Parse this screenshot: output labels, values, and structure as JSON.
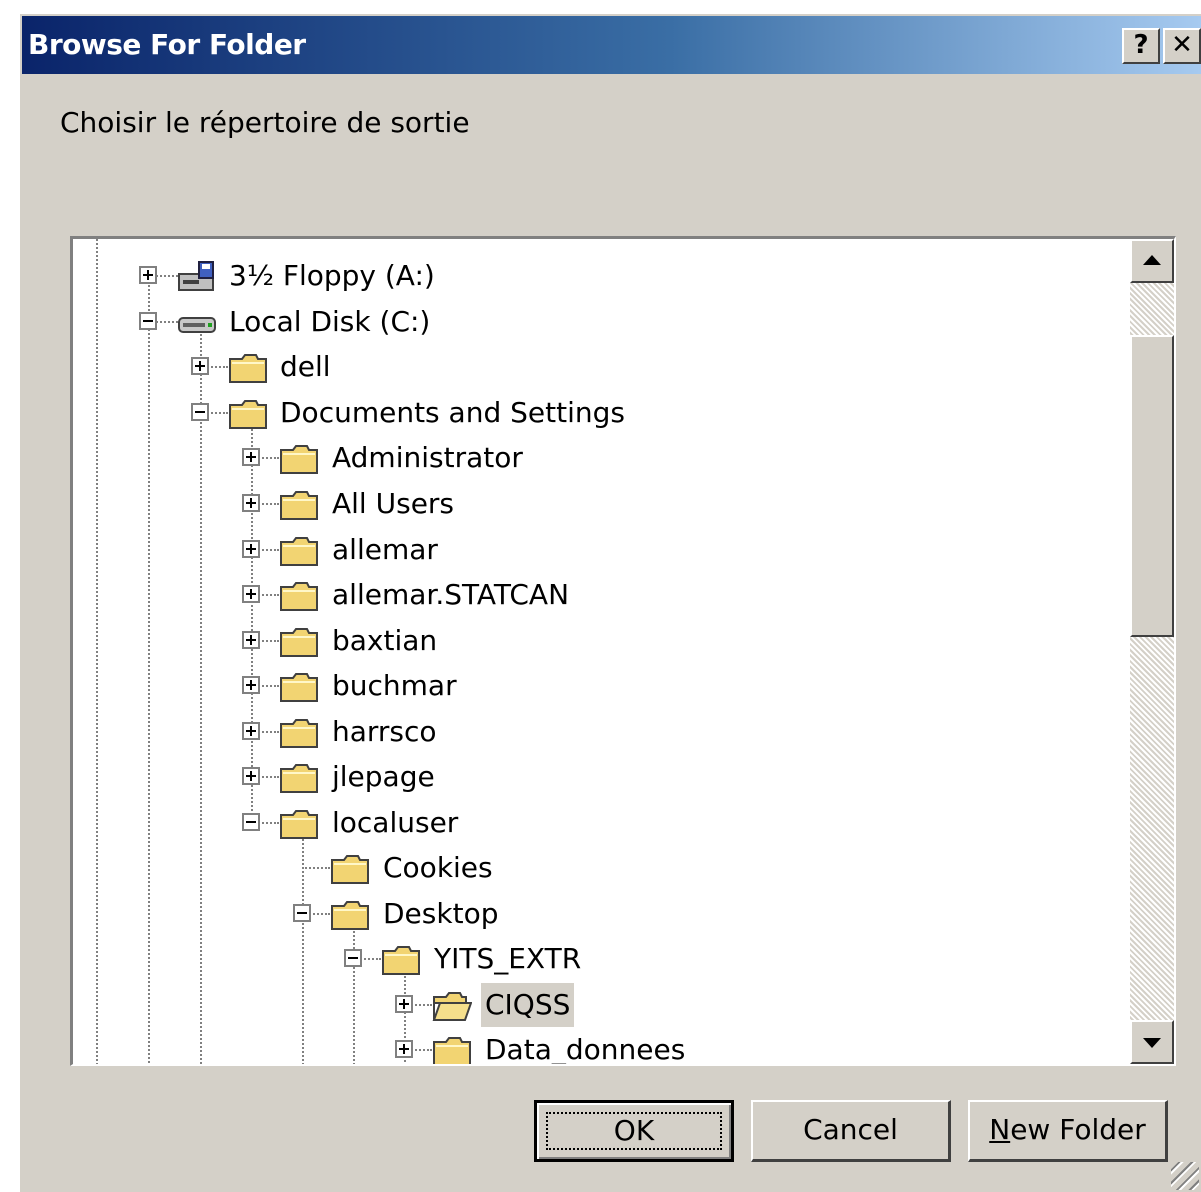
{
  "window": {
    "title": "Browse For Folder",
    "help_label": "?",
    "close_label": "✕"
  },
  "prompt": "Choisir le répertoire de sortie",
  "tree": {
    "items": [
      {
        "label": "3½ Floppy (A:)",
        "icon": "floppy-drive-icon",
        "expander": "plus"
      },
      {
        "label": "Local Disk (C:)",
        "icon": "hard-disk-icon",
        "expander": "minus"
      },
      {
        "label": "dell",
        "icon": "folder-icon",
        "expander": "plus"
      },
      {
        "label": "Documents and Settings",
        "icon": "folder-icon",
        "expander": "minus"
      },
      {
        "label": "Administrator",
        "icon": "folder-icon",
        "expander": "plus"
      },
      {
        "label": "All Users",
        "icon": "folder-icon",
        "expander": "plus"
      },
      {
        "label": "allemar",
        "icon": "folder-icon",
        "expander": "plus"
      },
      {
        "label": "allemar.STATCAN",
        "icon": "folder-icon",
        "expander": "plus"
      },
      {
        "label": "baxtian",
        "icon": "folder-icon",
        "expander": "plus"
      },
      {
        "label": "buchmar",
        "icon": "folder-icon",
        "expander": "plus"
      },
      {
        "label": "harrsco",
        "icon": "folder-icon",
        "expander": "plus"
      },
      {
        "label": "jlepage",
        "icon": "folder-icon",
        "expander": "plus"
      },
      {
        "label": "localuser",
        "icon": "folder-icon",
        "expander": "minus"
      },
      {
        "label": "Cookies",
        "icon": "folder-icon",
        "expander": "none"
      },
      {
        "label": "Desktop",
        "icon": "folder-icon",
        "expander": "minus"
      },
      {
        "label": "YITS_EXTR",
        "icon": "folder-icon",
        "expander": "minus"
      },
      {
        "label": "CIQSS",
        "icon": "open-folder-icon",
        "expander": "plus",
        "selected": true
      },
      {
        "label": "Data_donnees",
        "icon": "folder-icon",
        "expander": "plus"
      }
    ]
  },
  "buttons": {
    "ok": "OK",
    "cancel": "Cancel",
    "new_folder_mnemonic": "N",
    "new_folder_rest": "ew Folder"
  },
  "colors": {
    "title_gradient_start": "#0a246a",
    "title_gradient_end": "#a6caf0",
    "dialog_face": "#d4d0c8",
    "folder_yellow": "#f2d472"
  }
}
